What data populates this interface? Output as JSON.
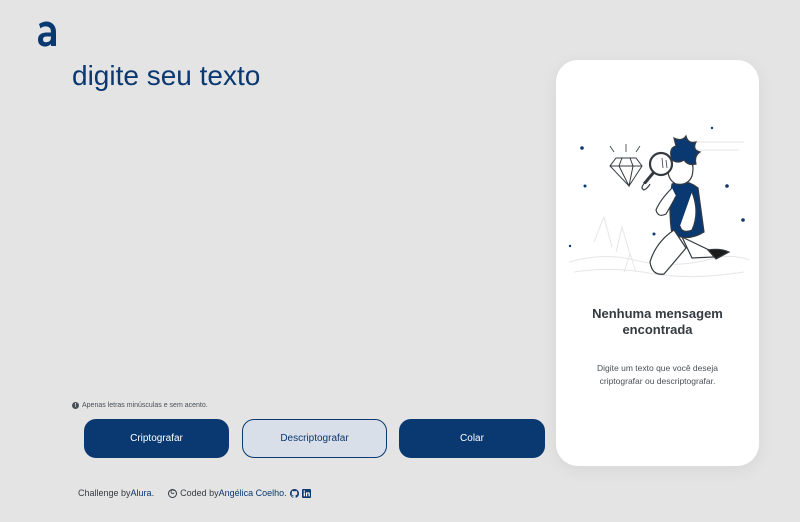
{
  "app": {
    "logo_icon": "alura-a-logo",
    "accent_color": "#0a3871"
  },
  "editor": {
    "placeholder": "digite seu texto",
    "value": ""
  },
  "hint": {
    "icon": "info-circle-icon",
    "text": "Apenas letras minúsculas e sem acento."
  },
  "buttons": {
    "encrypt_label": "Criptografar",
    "decrypt_label": "Descriptografar",
    "copy_label": "Colar"
  },
  "output_panel": {
    "illustration": "person-with-magnifying-glass",
    "title": "Nenhuma mensagem encontrada",
    "text": "Digite um texto que você deseja criptografar ou descriptografar."
  },
  "footer": {
    "challenge_prefix": "Challenge by ",
    "challenge_link": "Alura",
    "challenge_suffix": ".",
    "coded_prefix": "Coded by ",
    "author_link": "Angélica Coelho",
    "author_suffix": ".",
    "copyright_symbol": "C",
    "icons": [
      "github-icon",
      "linkedin-icon"
    ]
  }
}
